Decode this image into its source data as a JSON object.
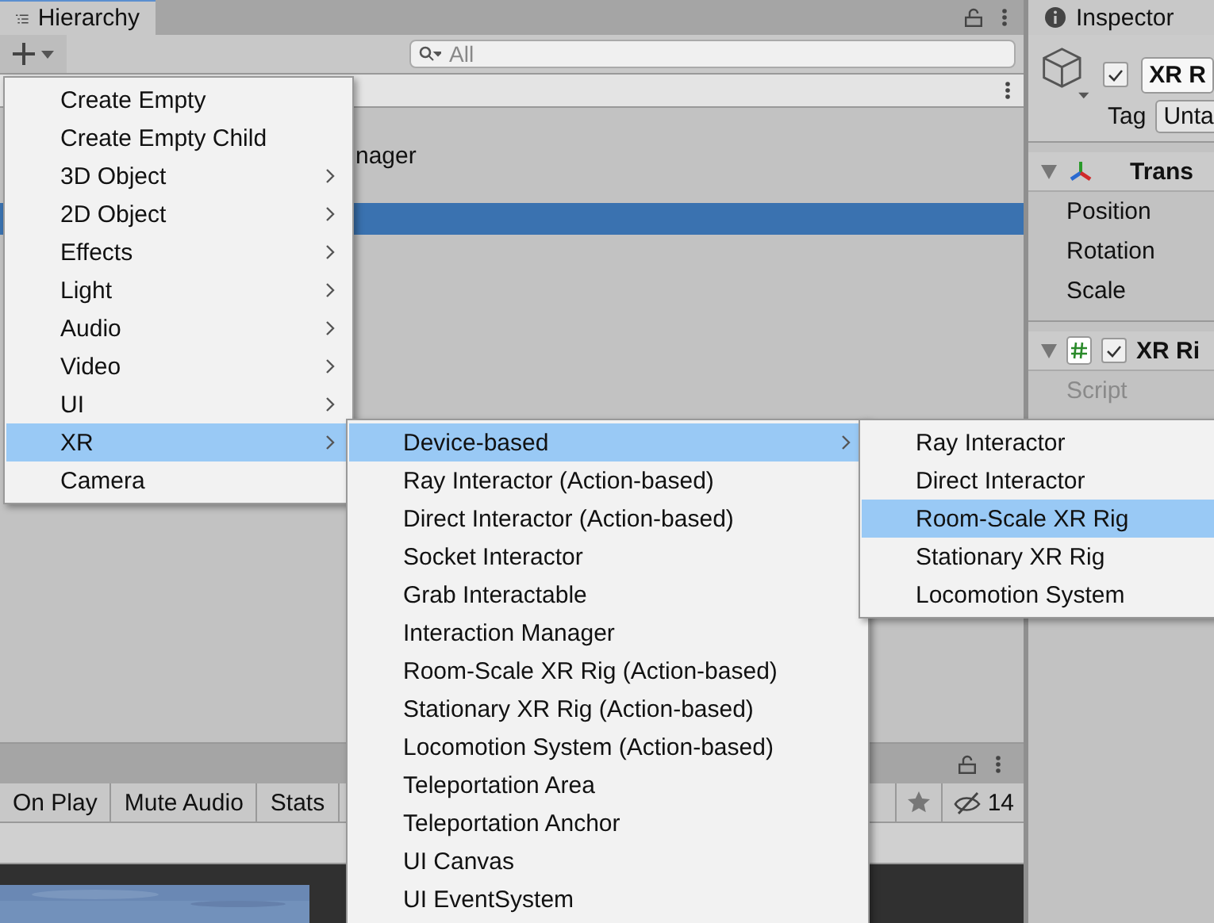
{
  "hierarchy": {
    "tab": "Hierarchy",
    "search": {
      "placeholder": "All"
    },
    "rows": [
      {
        "label": "nager",
        "selected": false
      },
      {
        "selected": true
      }
    ]
  },
  "game_view": {
    "toolbar": [
      {
        "label": "On Play"
      },
      {
        "label": "Mute Audio"
      },
      {
        "label": "Stats"
      }
    ],
    "hidden_count": "14"
  },
  "inspector": {
    "tab": "Inspector",
    "active": true,
    "name": "XR R",
    "tag_label": "Tag",
    "tag": "Unta",
    "components": [
      {
        "kind": "transform",
        "title": "Trans",
        "fields": [
          "Position",
          "Rotation",
          "Scale"
        ]
      },
      {
        "kind": "script",
        "title": "XR Ri",
        "enabled": true,
        "fields": [
          "Script"
        ]
      }
    ]
  },
  "menus": [
    {
      "items": [
        {
          "label": "Create Empty",
          "submenu": false,
          "selected": false
        },
        {
          "label": "Create Empty Child",
          "submenu": false,
          "selected": false
        },
        {
          "label": "3D Object",
          "submenu": true,
          "selected": false
        },
        {
          "label": "2D Object",
          "submenu": true,
          "selected": false
        },
        {
          "label": "Effects",
          "submenu": true,
          "selected": false
        },
        {
          "label": "Light",
          "submenu": true,
          "selected": false
        },
        {
          "label": "Audio",
          "submenu": true,
          "selected": false
        },
        {
          "label": "Video",
          "submenu": true,
          "selected": false
        },
        {
          "label": "UI",
          "submenu": true,
          "selected": false
        },
        {
          "label": "XR",
          "submenu": true,
          "selected": true
        },
        {
          "label": "Camera",
          "submenu": false,
          "selected": false
        }
      ]
    },
    {
      "items": [
        {
          "label": "Device-based",
          "submenu": true,
          "selected": true
        },
        {
          "label": "Ray Interactor (Action-based)",
          "submenu": false,
          "selected": false
        },
        {
          "label": "Direct Interactor (Action-based)",
          "submenu": false,
          "selected": false
        },
        {
          "label": "Socket Interactor",
          "submenu": false,
          "selected": false
        },
        {
          "label": "Grab Interactable",
          "submenu": false,
          "selected": false
        },
        {
          "label": "Interaction Manager",
          "submenu": false,
          "selected": false
        },
        {
          "label": "Room-Scale XR Rig (Action-based)",
          "submenu": false,
          "selected": false
        },
        {
          "label": "Stationary XR Rig (Action-based)",
          "submenu": false,
          "selected": false
        },
        {
          "label": "Locomotion System (Action-based)",
          "submenu": false,
          "selected": false
        },
        {
          "label": "Teleportation Area",
          "submenu": false,
          "selected": false
        },
        {
          "label": "Teleportation Anchor",
          "submenu": false,
          "selected": false
        },
        {
          "label": "UI Canvas",
          "submenu": false,
          "selected": false
        },
        {
          "label": "UI EventSystem",
          "submenu": false,
          "selected": false
        }
      ]
    },
    {
      "items": [
        {
          "label": "Ray Interactor",
          "submenu": false,
          "selected": false
        },
        {
          "label": "Direct Interactor",
          "submenu": false,
          "selected": false
        },
        {
          "label": "Room-Scale XR Rig",
          "submenu": false,
          "selected": true
        },
        {
          "label": "Stationary XR Rig",
          "submenu": false,
          "selected": false
        },
        {
          "label": "Locomotion System",
          "submenu": false,
          "selected": false
        }
      ]
    }
  ]
}
